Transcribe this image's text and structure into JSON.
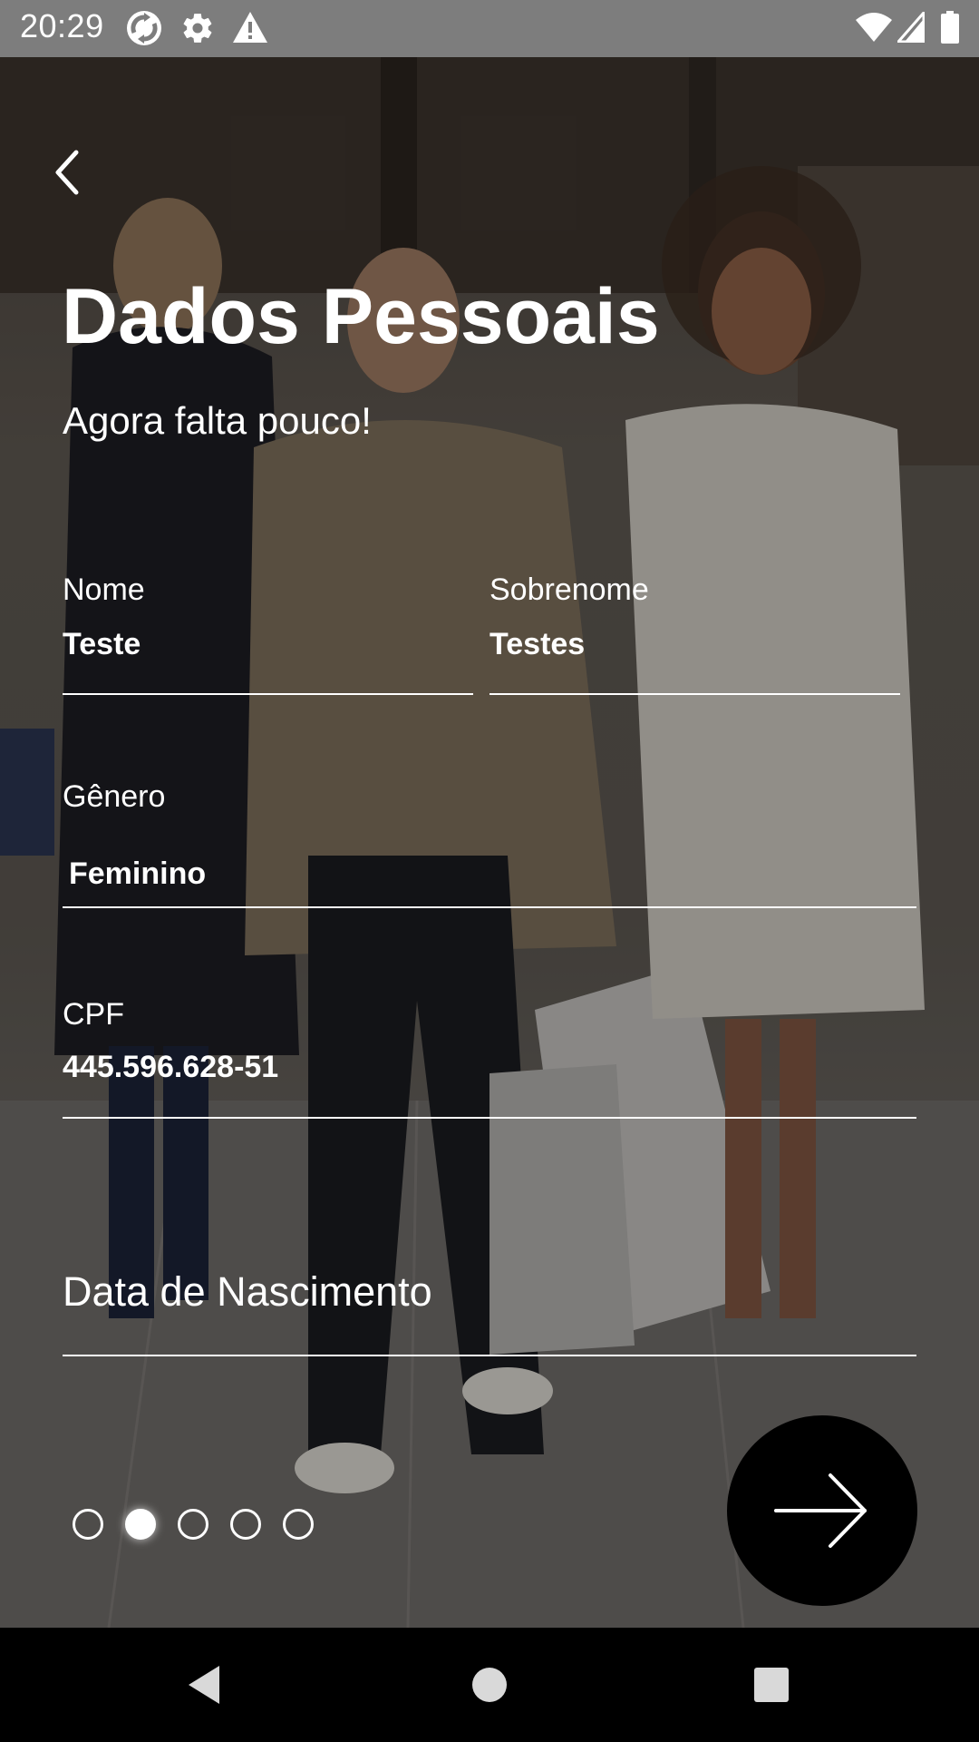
{
  "status_bar": {
    "time": "20:29",
    "left_icons": [
      "sync-icon",
      "settings-gear-icon",
      "warning-icon"
    ],
    "right_icons": [
      "wifi-icon",
      "cell-signal-icon",
      "battery-icon"
    ]
  },
  "header": {
    "back_icon": "chevron-left-icon",
    "title": "Dados Pessoais",
    "subtitle": "Agora falta pouco!"
  },
  "form": {
    "first_name": {
      "label": "Nome",
      "value": "Teste"
    },
    "last_name": {
      "label": "Sobrenome",
      "value": "Testes"
    },
    "gender": {
      "label": "Gênero",
      "value": "Feminino"
    },
    "cpf": {
      "label": "CPF",
      "value": "445.596.628-51"
    },
    "birth_date": {
      "placeholder": "Data de Nascimento",
      "value": ""
    }
  },
  "pager": {
    "total": 5,
    "active_index": 1
  },
  "next_button": {
    "icon": "arrow-right-icon"
  },
  "nav_bar": {
    "icons": [
      "nav-back-icon",
      "nav-home-icon",
      "nav-recents-icon"
    ]
  },
  "colors": {
    "text": "#ffffff",
    "status_bar_bg": "#7d7d7d",
    "next_button_bg": "#000000",
    "nav_bar_bg": "#000000"
  }
}
